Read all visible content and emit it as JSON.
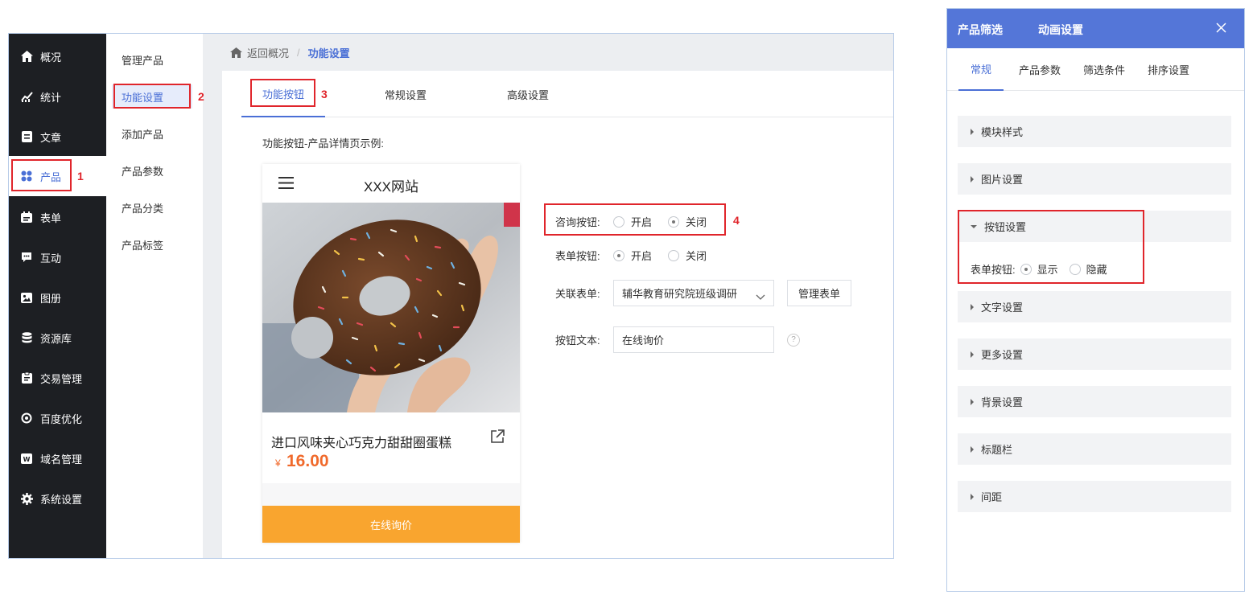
{
  "sidebar": {
    "items": [
      {
        "label": "概况",
        "icon": "home-icon"
      },
      {
        "label": "统计",
        "icon": "chart-icon"
      },
      {
        "label": "文章",
        "icon": "article-icon"
      },
      {
        "label": "产品",
        "icon": "product-icon",
        "active": true
      },
      {
        "label": "表单",
        "icon": "form-icon"
      },
      {
        "label": "互动",
        "icon": "chat-icon"
      },
      {
        "label": "图册",
        "icon": "album-icon"
      },
      {
        "label": "资源库",
        "icon": "database-icon"
      },
      {
        "label": "交易管理",
        "icon": "clipboard-icon"
      },
      {
        "label": "百度优化",
        "icon": "seo-icon"
      },
      {
        "label": "域名管理",
        "icon": "domain-icon"
      },
      {
        "label": "系统设置",
        "icon": "gear-icon"
      }
    ]
  },
  "submenu": {
    "items": [
      {
        "label": "管理产品"
      },
      {
        "label": "功能设置",
        "active": true
      },
      {
        "label": "添加产品"
      },
      {
        "label": "产品参数"
      },
      {
        "label": "产品分类"
      },
      {
        "label": "产品标签"
      }
    ]
  },
  "breadcrumb": {
    "back": "返回概况",
    "separator": "/",
    "current": "功能设置"
  },
  "tabs": [
    {
      "label": "功能按钮",
      "active": true
    },
    {
      "label": "常规设置"
    },
    {
      "label": "高级设置"
    }
  ],
  "annotations": {
    "n1": "1",
    "n2": "2",
    "n3": "3",
    "n4": "4"
  },
  "section_title": "功能按钮-产品详情页示例:",
  "preview": {
    "site_name": "XXX网站",
    "product_name": "进口风味夹心巧克力甜甜圈蛋糕",
    "currency": "¥",
    "price": "16.00",
    "cta": "在线询价"
  },
  "form": {
    "consult_label": "咨询按钮:",
    "form_button_label": "表单按钮:",
    "option_on": "开启",
    "option_off": "关闭",
    "linked_form_label": "关联表单:",
    "linked_form_value": "辅华教育研究院班级调研",
    "manage_form_button": "管理表单",
    "button_text_label": "按钮文本:",
    "button_text_value": "在线询价",
    "help": "?"
  },
  "right_panel": {
    "header_tabs": [
      "产品筛选",
      "动画设置"
    ],
    "tabs": [
      "常规",
      "产品参数",
      "筛选条件",
      "排序设置"
    ],
    "sections": [
      "模块样式",
      "图片设置",
      "按钮设置",
      "文字设置",
      "更多设置",
      "背景设置",
      "标题栏",
      "间距"
    ],
    "button_setting": {
      "label": "表单按钮:",
      "show": "显示",
      "hide": "隐藏"
    }
  },
  "colors": {
    "accent": "#4a6fd6",
    "sidebar_bg": "#1d1f23",
    "cta": "#f9a52f",
    "price": "#f06a2c",
    "annotation": "#e0252b",
    "panel_header": "#5476d8"
  }
}
